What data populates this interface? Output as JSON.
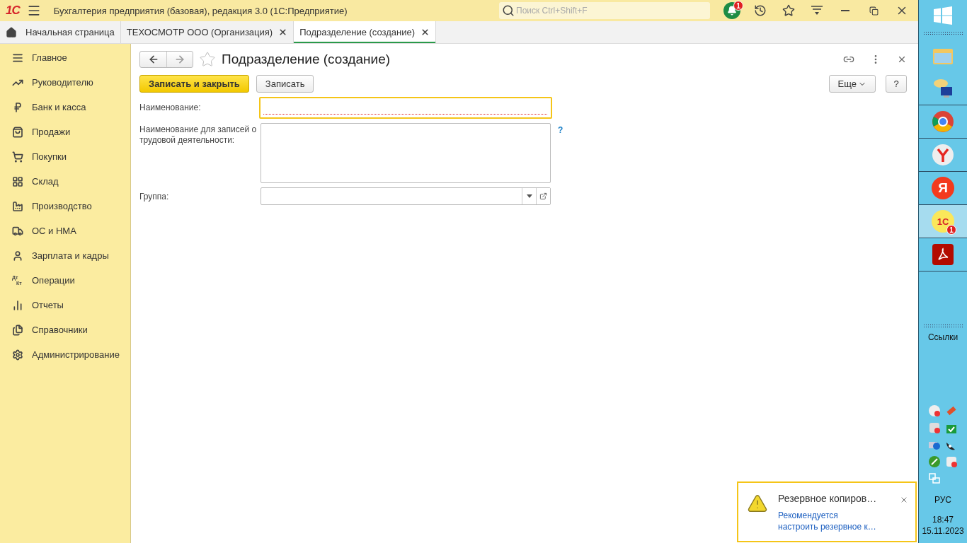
{
  "window": {
    "logo": "1С",
    "title": "Бухгалтерия предприятия (базовая), редакция 3.0  (1С:Предприятие)",
    "search": {
      "placeholder": "Поиск Ctrl+Shift+F"
    },
    "notifications_badge": "1"
  },
  "tabs": [
    {
      "label": "Начальная страница",
      "kind": "home",
      "selected": false
    },
    {
      "label": "ТЕХОСМОТР ООО (Организация)",
      "kind": "closable",
      "selected": false
    },
    {
      "label": "Подразделение (создание)",
      "kind": "closable",
      "selected": true
    }
  ],
  "sidebar": {
    "items": [
      {
        "label": "Главное"
      },
      {
        "label": "Руководителю"
      },
      {
        "label": "Банк и касса"
      },
      {
        "label": "Продажи"
      },
      {
        "label": "Покупки"
      },
      {
        "label": "Склад"
      },
      {
        "label": "Производство"
      },
      {
        "label": "ОС и НМА"
      },
      {
        "label": "Зарплата и кадры"
      },
      {
        "label": "Операции",
        "icon_text": [
          "Дт",
          "Кт"
        ]
      },
      {
        "label": "Отчеты"
      },
      {
        "label": "Справочники"
      },
      {
        "label": "Администрирование"
      }
    ]
  },
  "form": {
    "title": "Подразделение (создание)",
    "favorite": false,
    "buttons": [
      {
        "label": "Записать и закрыть",
        "kind": "primary"
      },
      {
        "label": "Записать",
        "kind": "default"
      }
    ],
    "more_button": "Еще",
    "help_button": "?",
    "fields": [
      {
        "label": "Наименование:",
        "kind": "text",
        "focused": true,
        "required": true
      },
      {
        "label": "Наименование для записей о трудовой деятельности:",
        "kind": "textarea",
        "focused": false,
        "required": false,
        "hint": "?"
      },
      {
        "label": "Группа:",
        "kind": "select",
        "focused": false,
        "required": false
      }
    ]
  },
  "notification": {
    "title": "Резервное копиров…",
    "lines": [
      "Рекомендуется",
      "настроить резервное к…"
    ]
  },
  "taskbar": {
    "apps": [
      {
        "kind": "folder",
        "selected": false
      },
      {
        "kind": "chat",
        "selected": false
      },
      {
        "kind": "chrome",
        "selected": false
      },
      {
        "kind": "ybrowser",
        "selected": false
      },
      {
        "kind": "yandex",
        "glyph": "Я",
        "selected": false
      },
      {
        "kind": "onec",
        "glyph": "1С",
        "badge": "1",
        "selected": true
      },
      {
        "kind": "pdf",
        "selected": false
      }
    ],
    "links_label": "Ссылки",
    "language": "РУС",
    "time": "18:47",
    "date": "15.11.2023"
  }
}
